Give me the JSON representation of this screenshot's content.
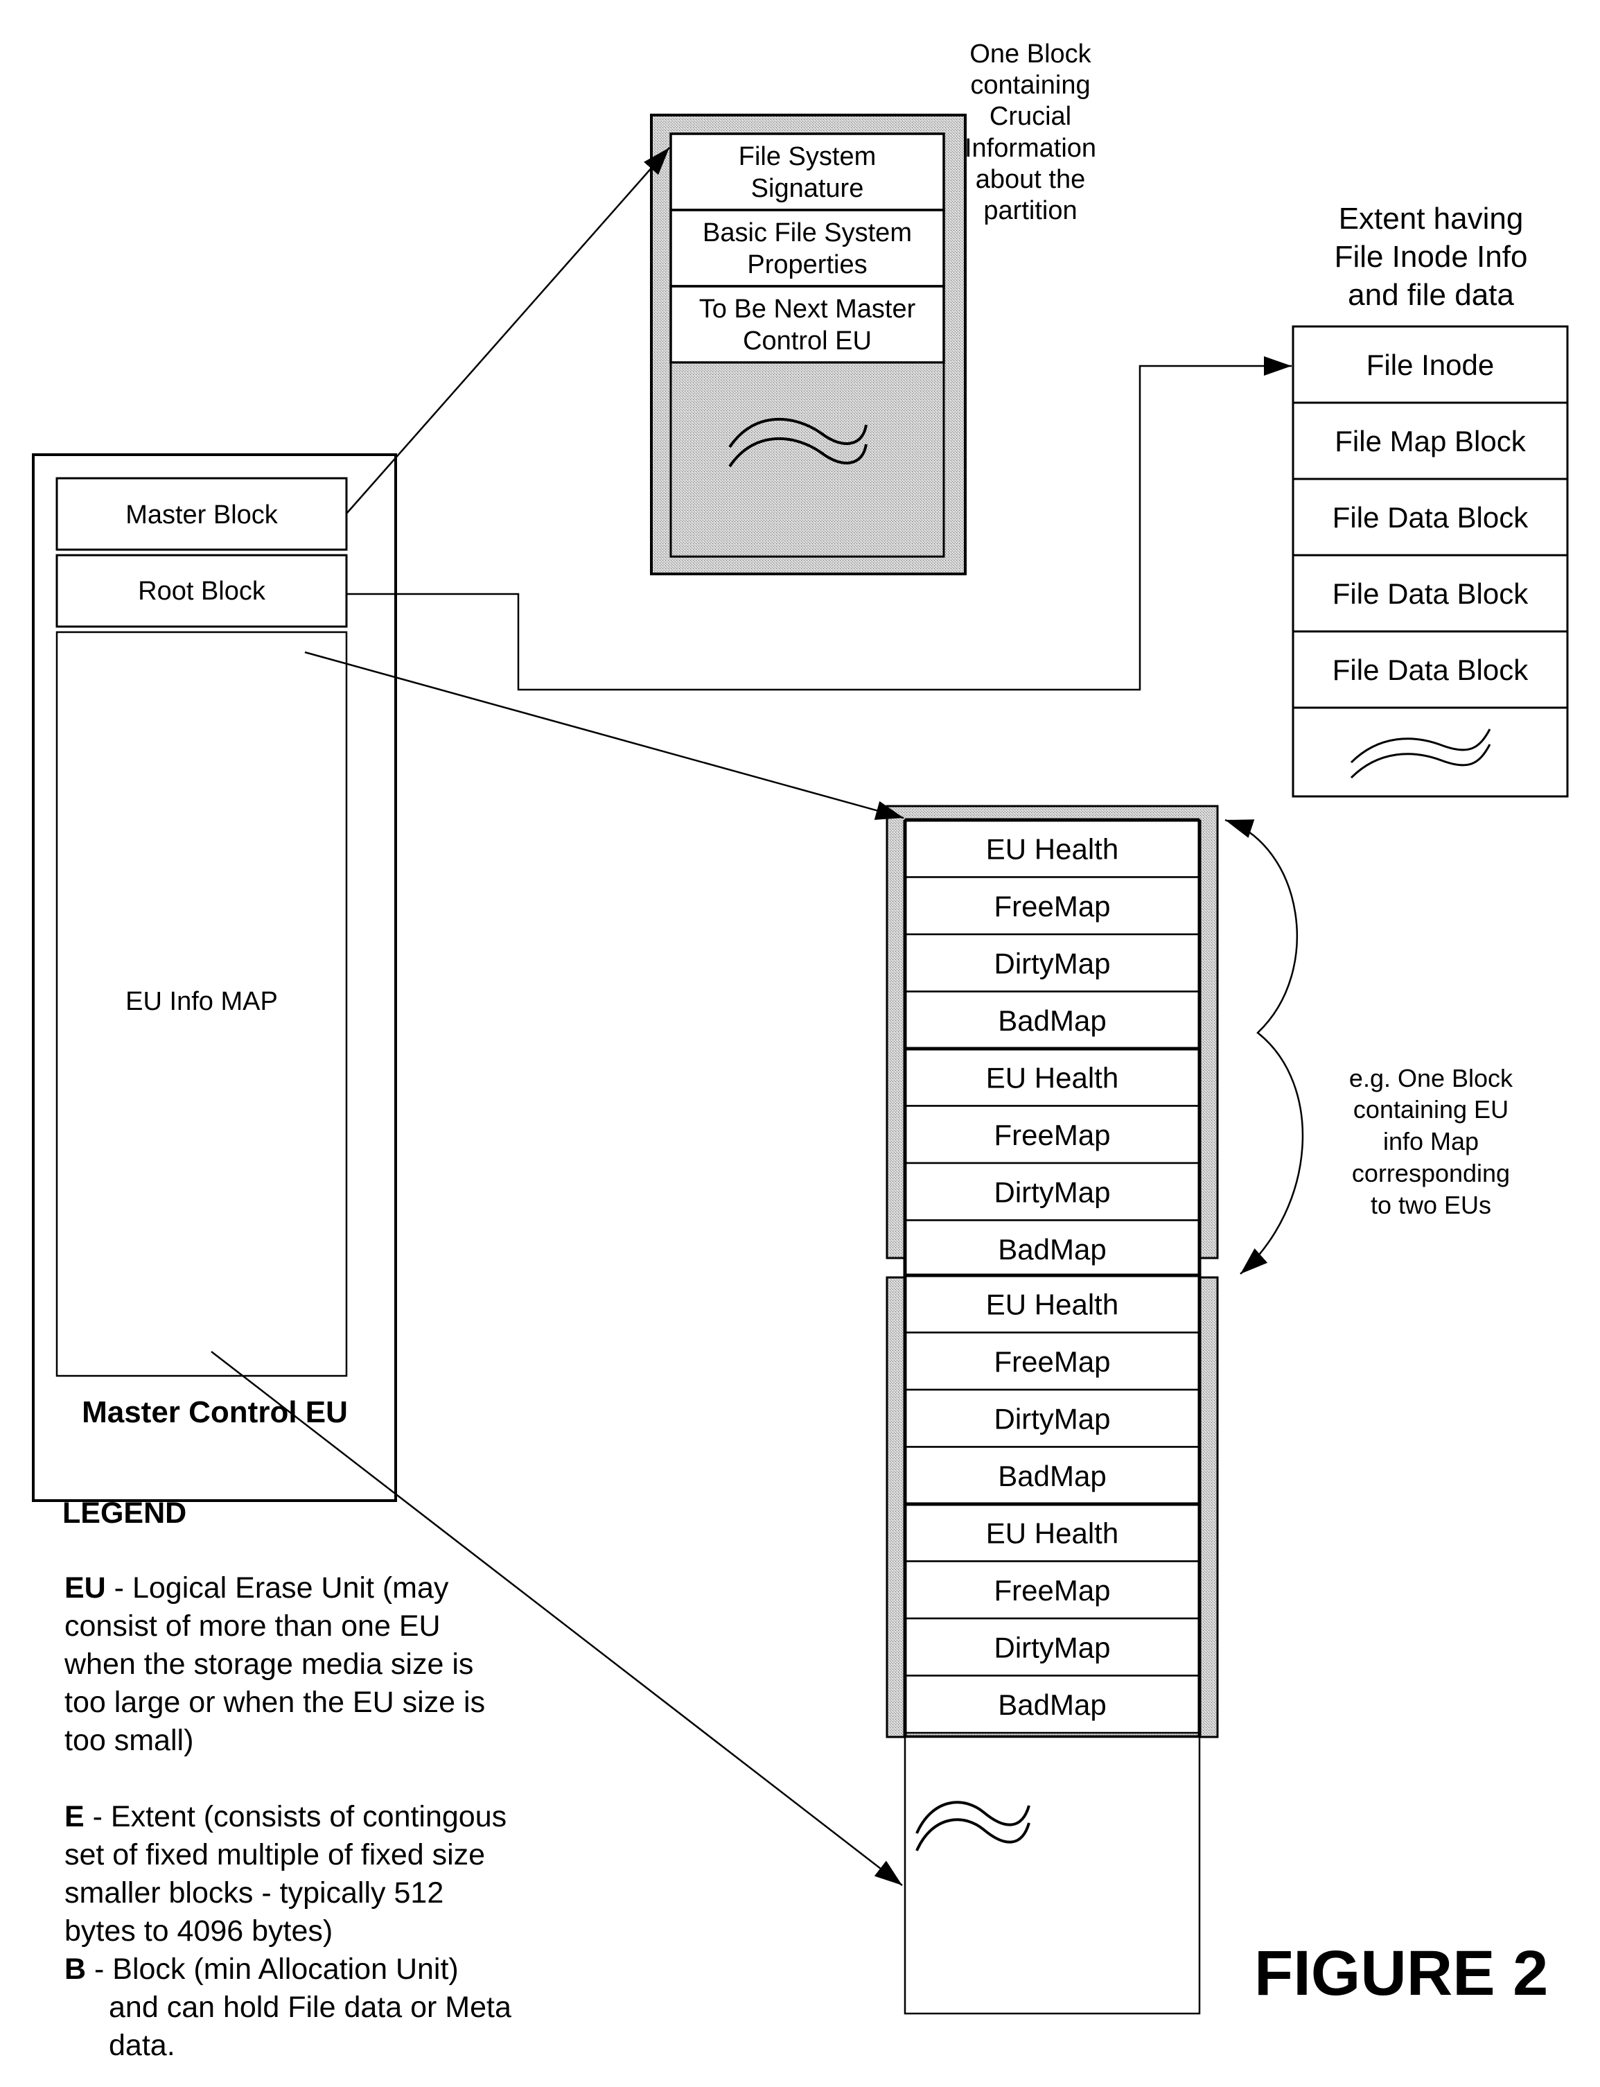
{
  "figure_label": "FIGURE 2",
  "master_control_eu": {
    "title": "Master Control EU",
    "blocks": [
      {
        "label": "Master Block"
      },
      {
        "label": "Root Block"
      },
      {
        "label": "EU Info MAP"
      }
    ]
  },
  "master_block_detail": {
    "annotation_lines": [
      "One Block",
      "containing",
      "Crucial",
      "Information",
      "about the",
      "partition"
    ],
    "rows": [
      {
        "lines": [
          "File System",
          "Signature"
        ]
      },
      {
        "lines": [
          "Basic File System",
          "Properties"
        ]
      },
      {
        "lines": [
          "To Be Next Master",
          "Control EU"
        ]
      }
    ],
    "continuation_icon": "wavy-break-icon"
  },
  "extent": {
    "title_lines": [
      "Extent having",
      "File Inode Info",
      "and file data"
    ],
    "rows": [
      "File Inode",
      "File Map Block",
      "File Data Block",
      "File Data Block",
      "File Data Block"
    ],
    "continuation_icon": "wavy-break-icon"
  },
  "eu_info_map": {
    "groups": [
      {
        "rows": [
          "EU Health",
          "FreeMap",
          "DirtyMap",
          "BadMap",
          "EU Health",
          "FreeMap",
          "DirtyMap",
          "BadMap"
        ]
      },
      {
        "rows": [
          "EU Health",
          "FreeMap",
          "DirtyMap",
          "BadMap",
          "EU Health",
          "FreeMap",
          "DirtyMap",
          "BadMap"
        ]
      }
    ],
    "annotation_lines": [
      "e.g. One Block",
      "containing EU",
      "info Map",
      "corresponding",
      "to two EUs"
    ],
    "continuation_icon": "wavy-break-icon"
  },
  "legend": {
    "title": "LEGEND",
    "entries": [
      {
        "term": "EU",
        "lines": [
          " - Logical Erase Unit (may",
          "consist of more than one EU",
          "when the storage media size is",
          "too large or when the EU size is",
          "too small)"
        ]
      },
      {
        "term": "E",
        "lines": [
          " - Extent (consists of contingous",
          "set of fixed multiple of fixed size",
          "smaller blocks - typically 512",
          "bytes to 4096 bytes)"
        ]
      },
      {
        "term": "B",
        "lines": [
          " - Block (min Allocation Unit)",
          "and can hold File data or Meta",
          "data."
        ]
      }
    ]
  }
}
